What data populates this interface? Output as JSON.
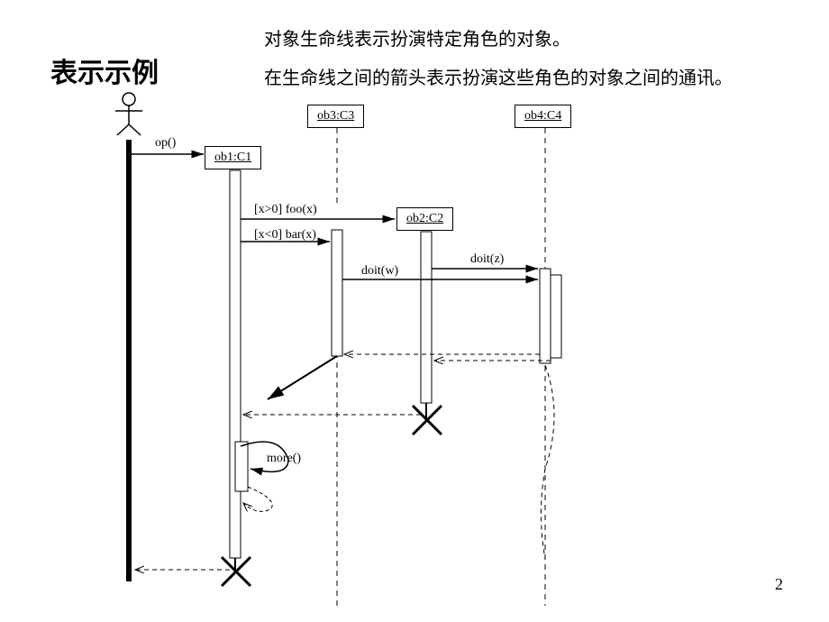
{
  "title": "表示示例",
  "description_line1": "对象生命线表示扮演特定角色的对象。",
  "description_line2": "在生命线之间的箭头表示扮演这些角色的对象之间的通讯。",
  "page_number": "2",
  "objects": {
    "ob1": "ob1:C1",
    "ob2": "ob2:C2",
    "ob3": "ob3:C3",
    "ob4": "ob4:C4"
  },
  "messages": {
    "op": "op()",
    "foo": "[x>0] foo(x)",
    "bar": "[x<0] bar(x)",
    "doit_z": "doit(z)",
    "doit_w": "doit(w)",
    "more": "more()"
  }
}
